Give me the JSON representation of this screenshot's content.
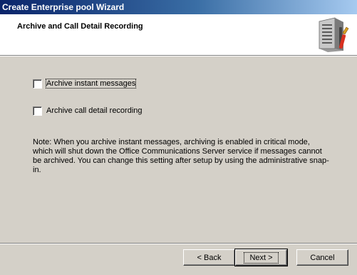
{
  "window": {
    "title": "Create Enterprise pool Wizard"
  },
  "header": {
    "title": "Archive and Call Detail Recording",
    "icon": "server-tools-icon"
  },
  "options": {
    "archive_im": {
      "label": "Archive instant messages",
      "checked": false
    },
    "archive_cdr": {
      "label": "Archive call detail recording",
      "checked": false
    }
  },
  "note": "Note: When you archive instant messages, archiving is enabled in critical mode, which will shut down the Office Communications Server service if messages cannot be archived. You can change this setting after setup by using the administrative snap-in.",
  "buttons": {
    "back": "< Back",
    "next": "Next >",
    "cancel": "Cancel"
  },
  "colors": {
    "titlebar_start": "#0a246a",
    "titlebar_end": "#a6caf0",
    "face": "#d4d0c8"
  }
}
